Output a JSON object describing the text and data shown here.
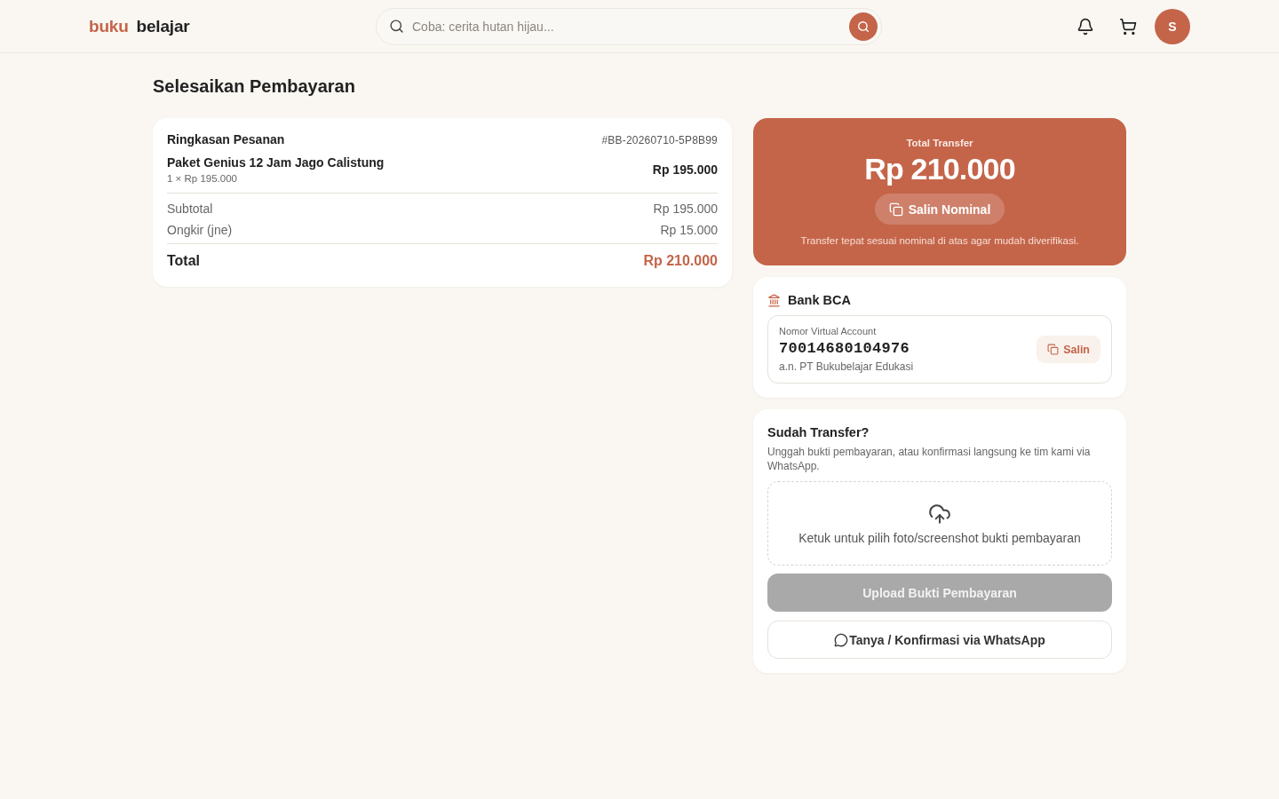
{
  "header": {
    "logo": {
      "part_1": "buku",
      "part_2": "belajar"
    },
    "search": {
      "placeholder": "Coba: cerita hutan hijau..."
    },
    "avatar": "S"
  },
  "page_title": "Selesaikan Pembayaran",
  "order_summary": {
    "title": "Ringkasan Pesanan",
    "order_id": "#BB-20260710-5P8B99",
    "items": [
      {
        "name": "Paket Genius 12 Jam Jago Calistung",
        "quantity_line": "1 × Rp 195.000",
        "price": "Rp 195.000"
      }
    ],
    "costs": [
      {
        "label": "Subtotal",
        "value": "Rp 195.000"
      },
      {
        "label": "Ongkir (jne)",
        "value": "Rp 15.000"
      }
    ],
    "total": {
      "label": "Total",
      "value": "Rp 210.000"
    }
  },
  "transfer": {
    "label": "Total Transfer",
    "amount": "Rp 210.000",
    "copy_button": "Salin Nominal",
    "note": "Transfer tepat sesuai nominal di atas agar mudah diverifikasi."
  },
  "bank": {
    "name": "Bank BCA",
    "account_label": "Nomor Virtual Account",
    "account_number": "70014680104976",
    "account_holder": "a.n. PT Bukubelajar Edukasi",
    "copy_button": "Salin"
  },
  "confirmation": {
    "title": "Sudah Transfer?",
    "description": "Unggah bukti pembayaran, atau konfirmasi langsung ke tim kami via WhatsApp.",
    "upload_area": "Ketuk untuk pilih foto/screenshot bukti pembayaran",
    "upload_button": {
      "label": "Upload Bukti Pembayaran",
      "disabled": true
    },
    "whatsapp_button": "Tanya / Konfirmasi via WhatsApp"
  }
}
